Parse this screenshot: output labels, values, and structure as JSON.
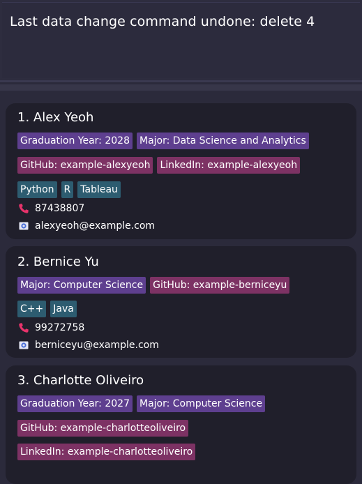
{
  "result": {
    "message": "Last data change command undone: delete 4"
  },
  "persons": [
    {
      "name": "1. Alex Yeoh",
      "tag_rows": [
        [
          {
            "label": "Graduation Year: 2028",
            "kind": "major"
          },
          {
            "label": "Major: Data Science and Analytics",
            "kind": "major"
          }
        ],
        [
          {
            "label": "GitHub: example-alexyeoh",
            "kind": "social"
          },
          {
            "label": "LinkedIn: example-alexyeoh",
            "kind": "social"
          }
        ],
        [
          {
            "label": "Python",
            "kind": "skill"
          },
          {
            "label": "R",
            "kind": "skill"
          },
          {
            "label": "Tableau",
            "kind": "skill"
          }
        ]
      ],
      "phone": "87438807",
      "email": "alexyeoh@example.com"
    },
    {
      "name": "2. Bernice Yu",
      "tag_rows": [
        [
          {
            "label": "Major: Computer Science",
            "kind": "major"
          },
          {
            "label": "GitHub: example-berniceyu",
            "kind": "social"
          }
        ],
        [
          {
            "label": "C++",
            "kind": "skill"
          },
          {
            "label": "Java",
            "kind": "skill"
          }
        ]
      ],
      "phone": "99272758",
      "email": "berniceyu@example.com"
    },
    {
      "name": "3. Charlotte Oliveiro",
      "tag_rows": [
        [
          {
            "label": "Graduation Year: 2027",
            "kind": "major"
          },
          {
            "label": "Major: Computer Science",
            "kind": "major"
          }
        ],
        [
          {
            "label": "GitHub: example-charlotteoliveiro",
            "kind": "social"
          }
        ],
        [
          {
            "label": "LinkedIn: example-charlotteoliveiro",
            "kind": "social"
          }
        ]
      ]
    }
  ],
  "icons": {
    "phone": "phone-icon",
    "email": "mail-icon"
  },
  "colors": {
    "major_tag": "#5e3f8f",
    "social_tag": "#7d3264",
    "skill_tag": "#2d5c70",
    "card_bg": "#201f2b",
    "page_bg": "#2b2a3b"
  }
}
